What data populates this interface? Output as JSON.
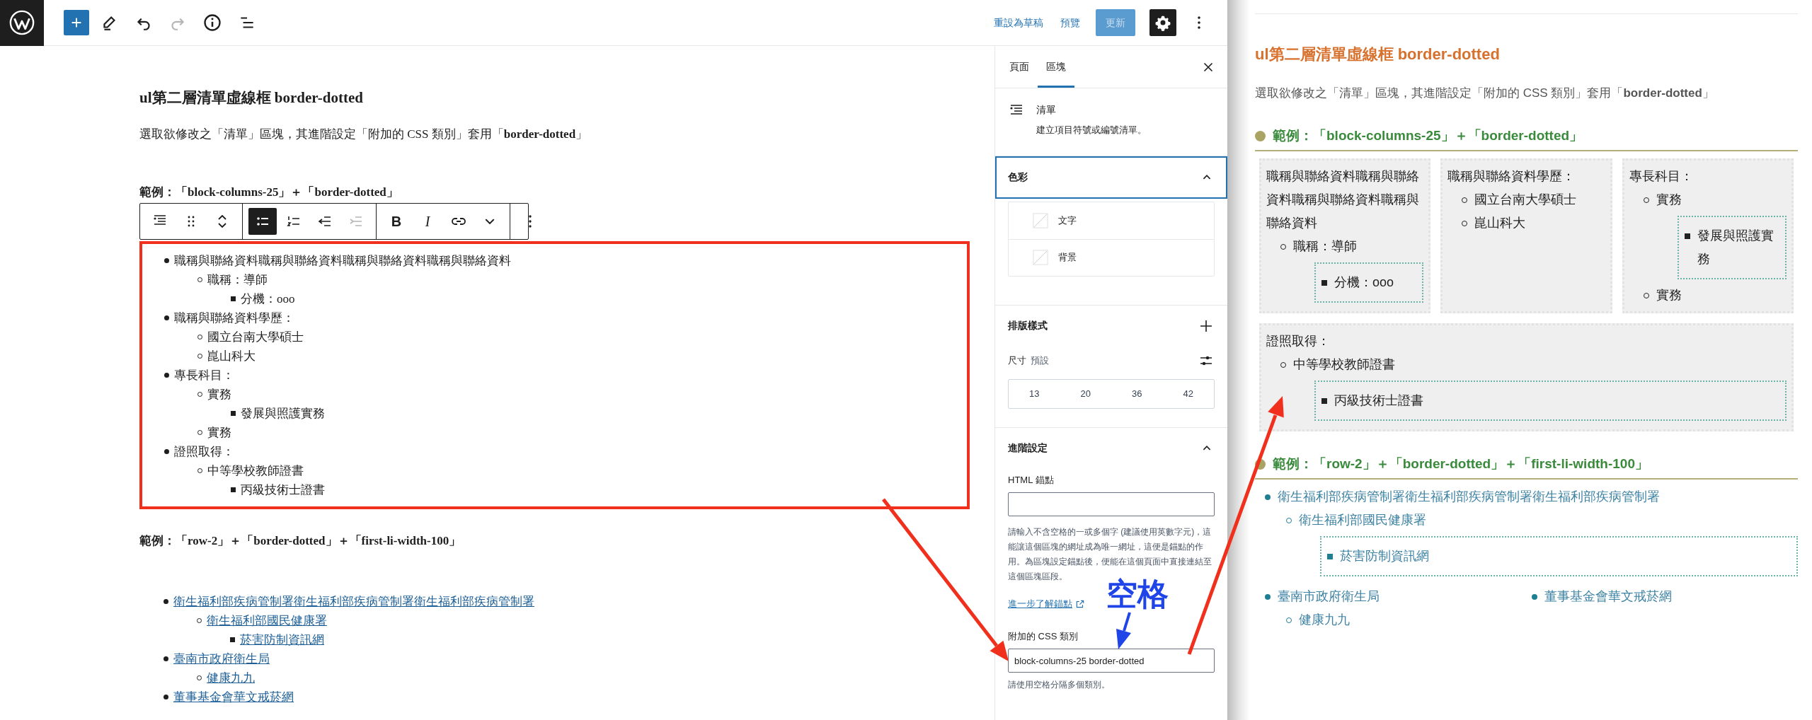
{
  "top_bar": {
    "redo_disabled": true,
    "settings_active": true,
    "actions": [
      {
        "kind": "link",
        "label": "重設為草稿"
      },
      {
        "kind": "link",
        "label": "預覽"
      },
      {
        "kind": "primary",
        "label": "更新",
        "disabled": true
      }
    ]
  },
  "editor": {
    "title": "ul第二層清單虛線框 border-dotted",
    "intro": "選取欲修改之「清單」區塊，其進階設定「附加的 CSS 類別」套用「**border-dotted**」",
    "example_1": "範例：「block-columns-25」＋「border-dotted」",
    "toolbar": {
      "ordered": false,
      "indent_disabled": true,
      "bold": "B",
      "italic": "I"
    },
    "selected_list": [
      {
        "text": "職稱與聯絡資料職稱與聯絡資料職稱與聯絡資料職稱與聯絡資料",
        "children": [
          {
            "text": "職稱：導師",
            "children": [
              {
                "text": "分機：ooo"
              }
            ]
          }
        ]
      },
      {
        "text": "職稱與聯絡資料學歷：",
        "children": [
          {
            "text": "國立台南大學碩士"
          },
          {
            "text": "崑山科大"
          }
        ]
      },
      {
        "text": "專長科目：",
        "children": [
          {
            "text": "實務",
            "children": [
              {
                "text": "發展與照護實務"
              }
            ]
          },
          {
            "text": "實務"
          }
        ]
      },
      {
        "text": "證照取得：",
        "children": [
          {
            "text": "中等學校教師證書",
            "children": [
              {
                "text": "丙級技術士證書"
              }
            ]
          }
        ]
      }
    ],
    "example_2": "範例：「row-2」＋「border-dotted」＋「first-li-width-100」",
    "link_list": [
      {
        "text": "衛生福利部疾病管制署衛生福利部疾病管制署衛生福利部疾病管制署",
        "children": [
          {
            "text": "衛生福利部國民健康署",
            "children": [
              {
                "text": "菸害防制資訊網"
              }
            ]
          }
        ]
      },
      {
        "text": "臺南市政府衛生局",
        "children": [
          {
            "text": "健康九九"
          }
        ]
      },
      {
        "text": "董事基金會華文戒菸網"
      }
    ]
  },
  "sidebar": {
    "tabs": [
      {
        "label": "頁面",
        "selected": false
      },
      {
        "label": "區塊",
        "selected": true
      }
    ],
    "block": {
      "name": "清單",
      "description": "建立項目符號或編號清單。"
    },
    "color_panel": {
      "title": "色彩",
      "expanded": true,
      "focused": true,
      "items": [
        "文字",
        "背景"
      ]
    },
    "typography_panel": {
      "title": "排版樣式",
      "size_label": "尺寸",
      "size_value": "預設",
      "sizes": [
        "13",
        "20",
        "36",
        "42"
      ]
    },
    "advanced_panel": {
      "title": "進階設定",
      "expanded": true,
      "anchor_label": "HTML 錨點",
      "anchor_help": "請輸入不含空格的一或多個字 (建議使用英數字元)，這能讓這個區塊的網址成為唯一網址，這便是錨點的作用。為區塊設定錨點後，便能在這個頁面中直接連結至這個區塊區段。",
      "anchor_link": "進一步了解錨點",
      "css_label": "附加的 CSS 類別",
      "css_value": "block-columns-25 border-dotted",
      "css_help": "請使用空格分隔多個類別。"
    }
  },
  "annotation": {
    "label": "空格"
  },
  "preview": {
    "title": "ul第二層清單虛線框 border-dotted",
    "intro": "選取欲修改之「清單」區塊，其進階設定「附加的 CSS 類別」套用「**border-dotted**」",
    "example_1": "範例：「block-columns-25」＋「border-dotted」",
    "block_list": [
      {
        "text": "職稱與聯絡資料職稱與聯絡資料職稱與聯絡資料職稱與聯絡資料",
        "children": [
          {
            "text": "職稱：導師",
            "children": [
              {
                "text": "分機：ooo"
              }
            ]
          }
        ]
      },
      {
        "text": "職稱與聯絡資料學歷：",
        "children": [
          {
            "text": "國立台南大學碩士"
          },
          {
            "text": "崑山科大"
          }
        ]
      },
      {
        "text": "專長科目：",
        "children": [
          {
            "text": "實務",
            "children": [
              {
                "text": "發展與照護實務"
              }
            ]
          },
          {
            "text": "實務"
          }
        ]
      },
      {
        "text": "證照取得：",
        "children": [
          {
            "text": "中等學校教師證書",
            "children": [
              {
                "text": "丙級技術士證書"
              }
            ]
          }
        ]
      }
    ],
    "example_2": "範例：「row-2」＋「border-dotted」＋「first-li-width-100」",
    "link_list": [
      {
        "text": "衛生福利部疾病管制署衛生福利部疾病管制署衛生福利部疾病管制署",
        "children": [
          {
            "text": "衛生福利部國民健康署",
            "children": [
              {
                "text": "菸害防制資訊網"
              }
            ]
          }
        ]
      },
      {
        "text": "臺南市政府衛生局",
        "children": [
          {
            "text": "健康九九"
          }
        ]
      },
      {
        "text": "董事基金會華文戒菸網"
      }
    ]
  }
}
